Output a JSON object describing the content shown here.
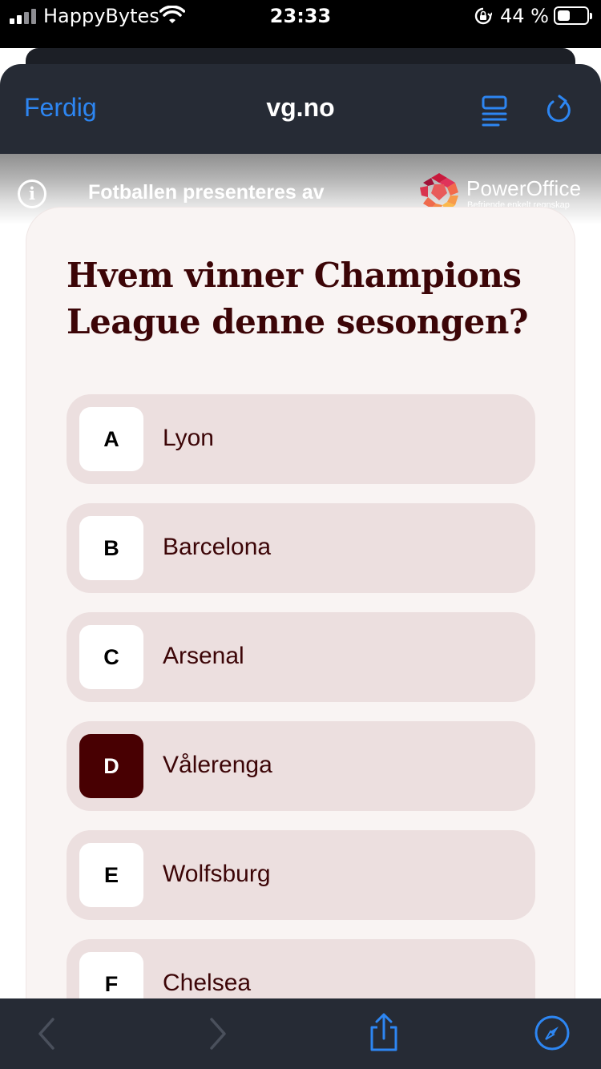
{
  "status_bar": {
    "carrier": "HappyBytes",
    "time": "23:33",
    "battery_percent": "44 %",
    "battery_level": 0.44
  },
  "browser": {
    "done_label": "Ferdig",
    "url": "vg.no"
  },
  "sponsor": {
    "text": "Fotballen presenteres av",
    "brand_name": "PowerOffice",
    "brand_tagline": "Befriende enkelt regnskap"
  },
  "quiz": {
    "question": "Hvem vinner Champions League denne sesongen?",
    "options": [
      {
        "letter": "A",
        "label": "Lyon"
      },
      {
        "letter": "B",
        "label": "Barcelona"
      },
      {
        "letter": "C",
        "label": "Arsenal"
      },
      {
        "letter": "D",
        "label": "Vålerenga",
        "selected": true
      },
      {
        "letter": "E",
        "label": "Wolfsburg"
      },
      {
        "letter": "F",
        "label": "Chelsea"
      }
    ]
  },
  "colors": {
    "accent_blue": "#2d86f2",
    "question_text": "#3c0507",
    "selected_letter_bg": "#480002",
    "option_bg": "#ecdfdf",
    "card_bg": "#f9f4f3",
    "chrome_bg": "#262b35"
  }
}
